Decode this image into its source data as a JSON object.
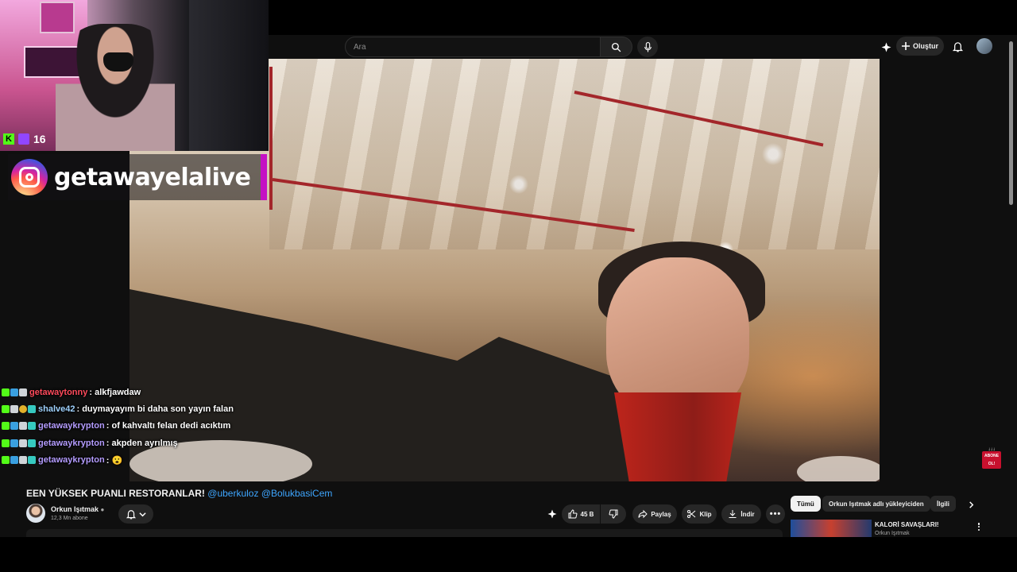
{
  "header": {
    "search_placeholder": "Ara",
    "create_label": "Oluştur"
  },
  "overlay": {
    "viewer_count": "16",
    "instagram_handle": "getawayelalive"
  },
  "chat": [
    {
      "user": "getawaytonny",
      "user_color": "#ff4b5c",
      "message": ": alkfjawdaw"
    },
    {
      "user": "shalve42",
      "user_color": "#9fd2ff",
      "message": ": duymayayım bi daha son yayın falan"
    },
    {
      "user": "getawaykrypton",
      "user_color": "#b49cff",
      "message": ": of kahvaltı felan dedi acıktım"
    },
    {
      "user": "getawaykrypton",
      "user_color": "#b49cff",
      "message": ": akpden ayrılmış"
    },
    {
      "user": "getawaykrypton",
      "user_color": "#b49cff",
      "message": ": 😮"
    }
  ],
  "video": {
    "title_main": "EEN YÜKSEK PUANLI RESTORANLAR!",
    "title_tags": "@uberkuloz @BolukbasiCem",
    "channel_name": "Orkun Işıtmak",
    "subscribers": "12,3 Mn abone",
    "likes": "45 B",
    "share_label": "Paylaş",
    "clip_label": "Klip",
    "download_label": "İndir",
    "abone_badge": "ABONE OL!"
  },
  "sidebar": {
    "chips": [
      "Tümü",
      "Orkun Işıtmak adlı yükleyiciden",
      "İlgili"
    ],
    "rec_title": "KALORİ SAVAŞLARI!",
    "rec_channel": "Orkun Işıtmak"
  },
  "colors": {
    "bg": "#0f0f0f",
    "kick_green": "#53fc18",
    "twitch_purple": "#9146ff",
    "link_blue": "#3ea6ff"
  }
}
